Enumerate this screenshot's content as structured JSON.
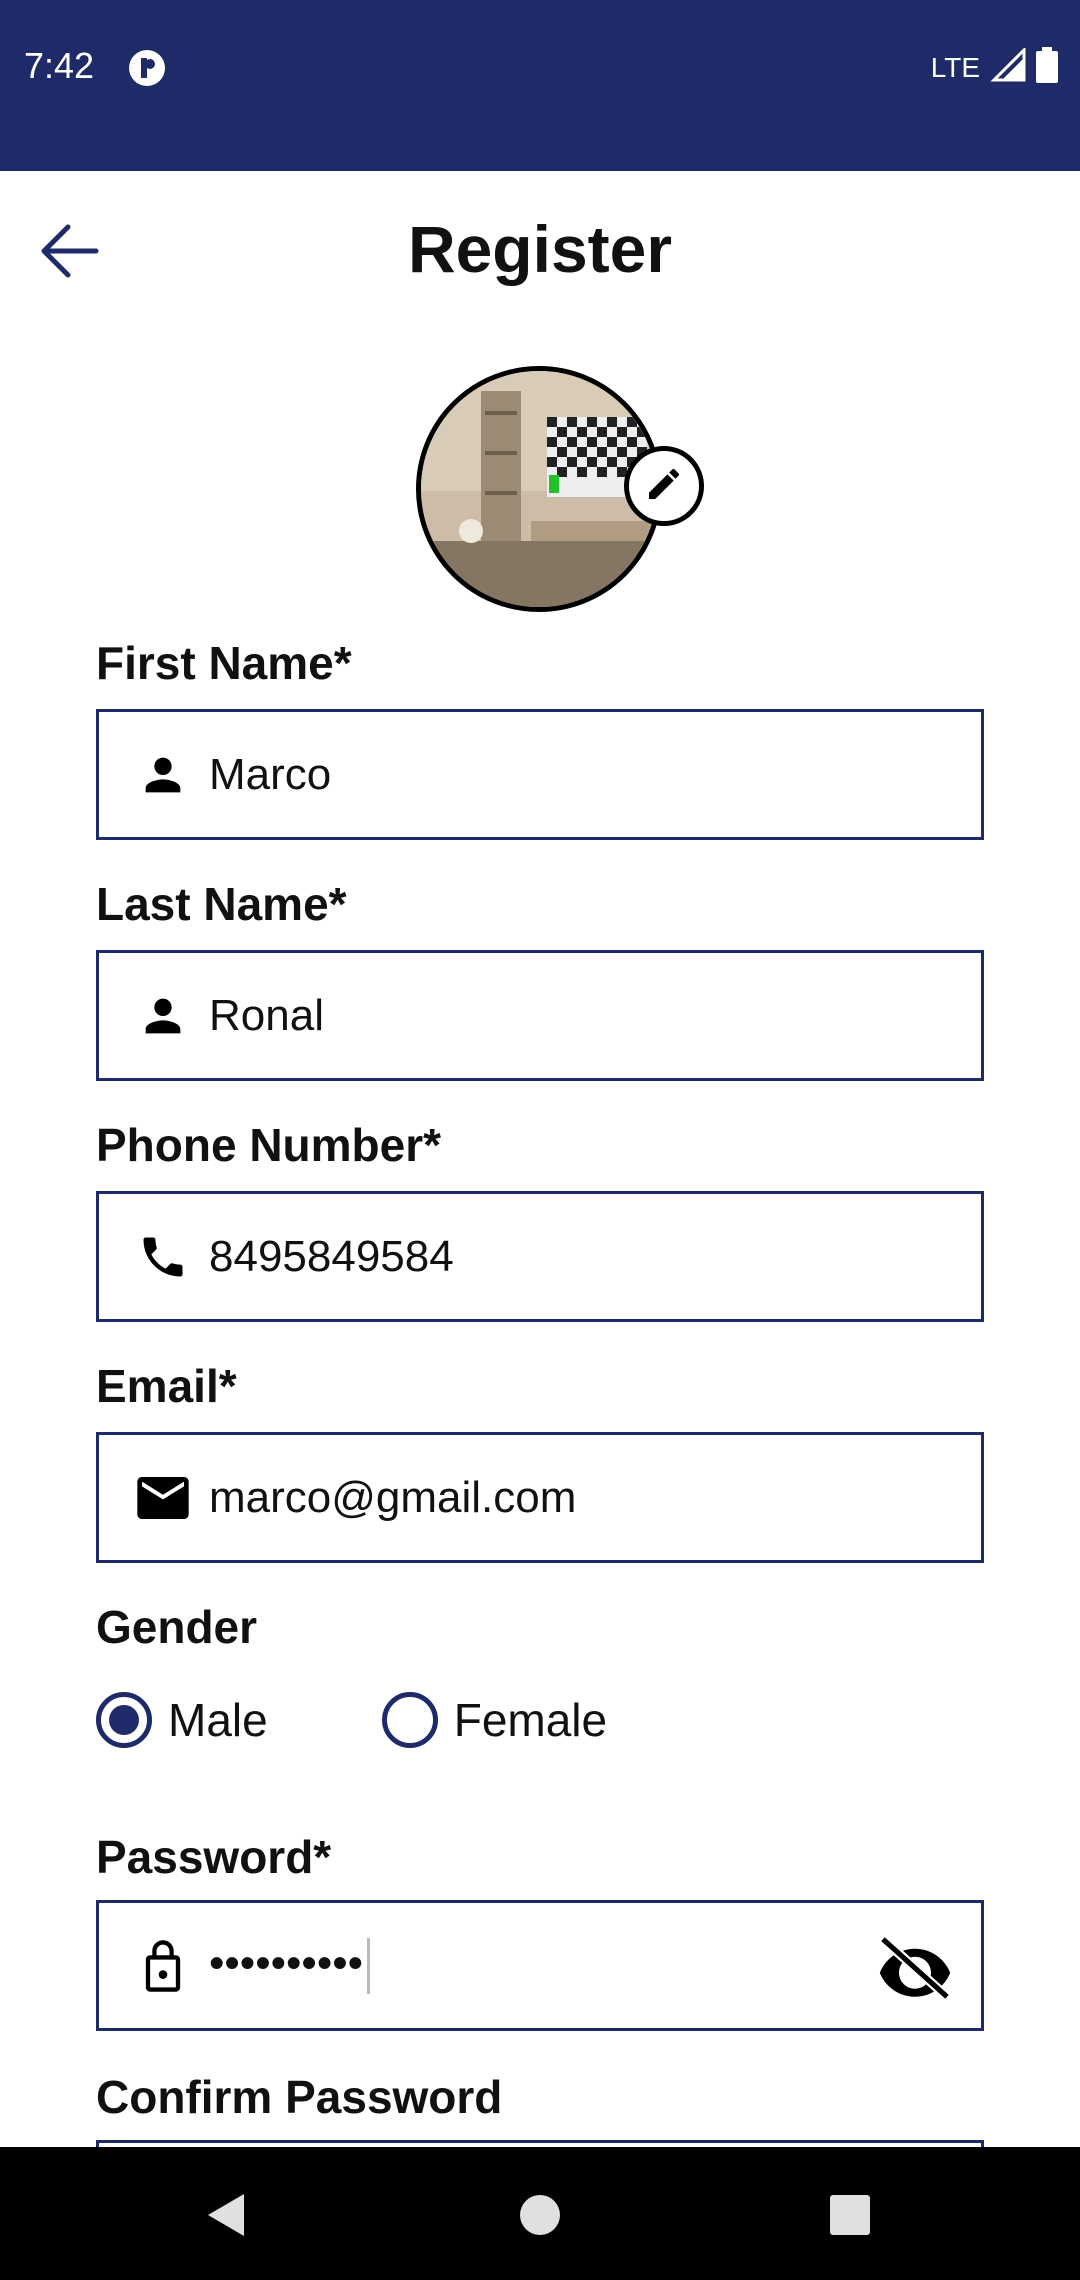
{
  "status_bar": {
    "time": "7:42",
    "network": "LTE",
    "icons": [
      "app-notification-icon",
      "signal-icon",
      "battery-icon"
    ]
  },
  "app_bar": {
    "title": "Register",
    "back_icon": "arrow-left-icon"
  },
  "profile": {
    "edit_icon": "pencil-icon"
  },
  "form": {
    "first_name": {
      "label": "First Name*",
      "value": "Marco",
      "icon": "person-icon"
    },
    "last_name": {
      "label": "Last Name*",
      "value": "Ronal",
      "icon": "person-icon"
    },
    "phone": {
      "label": "Phone Number*",
      "value": "8495849584",
      "icon": "phone-icon"
    },
    "email": {
      "label": "Email*",
      "value": "marco@gmail.com",
      "icon": "mail-icon"
    },
    "gender": {
      "label": "Gender",
      "options": [
        "Male",
        "Female"
      ],
      "selected": "Male"
    },
    "password": {
      "label": "Password*",
      "value": "••••••••••",
      "icon": "lock-icon",
      "toggle_icon": "eye-off-icon"
    },
    "confirm_password": {
      "label": "Confirm Password"
    }
  },
  "colors": {
    "primary": "#1f2a68",
    "nav_bar": "#000000",
    "background": "#ffffff"
  }
}
